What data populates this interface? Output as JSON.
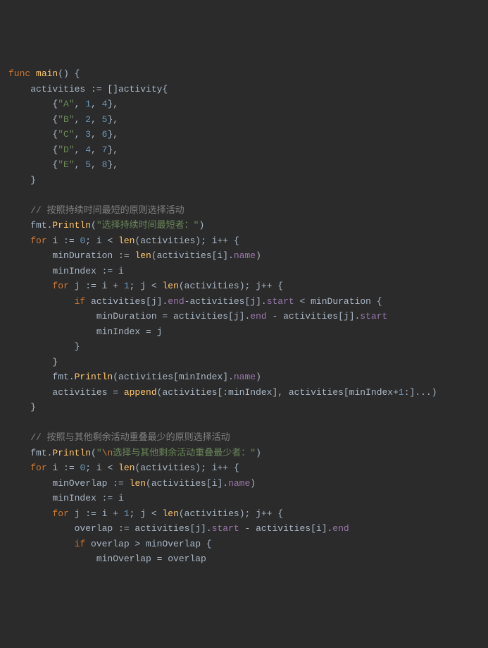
{
  "code": {
    "l1_func": "func",
    "l1_main": "main",
    "l1_rest": "() {",
    "l2_a": "    activities := []activity{",
    "l3_a": "        {",
    "l3_s": "\"A\"",
    "l3_c1": ", ",
    "l3_n1": "1",
    "l3_c2": ", ",
    "l3_n2": "4",
    "l3_e": "},",
    "l4_a": "        {",
    "l4_s": "\"B\"",
    "l4_n1": "2",
    "l4_n2": "5",
    "l5_a": "        {",
    "l5_s": "\"C\"",
    "l5_n1": "3",
    "l5_n2": "6",
    "l6_a": "        {",
    "l6_s": "\"D\"",
    "l6_n1": "4",
    "l6_n2": "7",
    "l7_a": "        {",
    "l7_s": "\"E\"",
    "l7_n1": "5",
    "l7_n2": "8",
    "l8": "    }",
    "l9": "",
    "l10_cmt": "    // 按照持续时间最短的原则选择活动",
    "l11_a": "    fmt.",
    "l11_fn": "Println",
    "l11_p1": "(",
    "l11_s": "\"选择持续时间最短者：\"",
    "l11_p2": ")",
    "l12_a": "    ",
    "l12_for": "for",
    "l12_b": " i := ",
    "l12_n0": "0",
    "l12_c": "; i < ",
    "l12_len": "len",
    "l12_d": "(activities); i++ {",
    "l13_a": "        minDuration := ",
    "l13_len": "len",
    "l13_b": "(activities[i].",
    "l13_name": "name",
    "l13_c": ")",
    "l14": "        minIndex := i",
    "l15_a": "        ",
    "l15_for": "for",
    "l15_b": " j := i + ",
    "l15_n1": "1",
    "l15_c": "; j < ",
    "l15_len": "len",
    "l15_d": "(activities); j++ {",
    "l16_a": "            ",
    "l16_if": "if",
    "l16_b": " activities[j].",
    "l16_end": "end",
    "l16_c": "-activities[j].",
    "l16_start": "start",
    "l16_d": " < minDuration {",
    "l17_a": "                minDuration = activities[j].",
    "l17_end": "end",
    "l17_b": " - activities[j].",
    "l17_start": "start",
    "l18": "                minIndex = j",
    "l19": "            }",
    "l20": "        }",
    "l21_a": "        fmt.",
    "l21_fn": "Println",
    "l21_b": "(activities[minIndex].",
    "l21_name": "name",
    "l21_c": ")",
    "l22_a": "        activities = ",
    "l22_app": "append",
    "l22_b": "(activities[:minIndex], activities[minIndex+",
    "l22_n1": "1",
    "l22_c": ":]...)",
    "l23": "    }",
    "l24": "",
    "l25_cmt": "    // 按照与其他剩余活动重叠最少的原则选择活动",
    "l26_a": "    fmt.",
    "l26_fn": "Println",
    "l26_p1": "(",
    "l26_s1": "\"",
    "l26_esc": "\\n",
    "l26_s2": "选择与其他剩余活动重叠最少者：\"",
    "l26_p2": ")",
    "l27_a": "    ",
    "l27_for": "for",
    "l27_b": " i := ",
    "l27_n0": "0",
    "l27_c": "; i < ",
    "l27_len": "len",
    "l27_d": "(activities); i++ {",
    "l28_a": "        minOverlap := ",
    "l28_len": "len",
    "l28_b": "(activities[i].",
    "l28_name": "name",
    "l28_c": ")",
    "l29": "        minIndex := i",
    "l30_a": "        ",
    "l30_for": "for",
    "l30_b": " j := i + ",
    "l30_n1": "1",
    "l30_c": "; j < ",
    "l30_len": "len",
    "l30_d": "(activities); j++ {",
    "l31_a": "            overlap := activities[j].",
    "l31_start": "start",
    "l31_b": " - activities[i].",
    "l31_end": "end",
    "l32_a": "            ",
    "l32_if": "if",
    "l32_b": " overlap > minOverlap {",
    "l33": "                minOverlap = overlap"
  }
}
